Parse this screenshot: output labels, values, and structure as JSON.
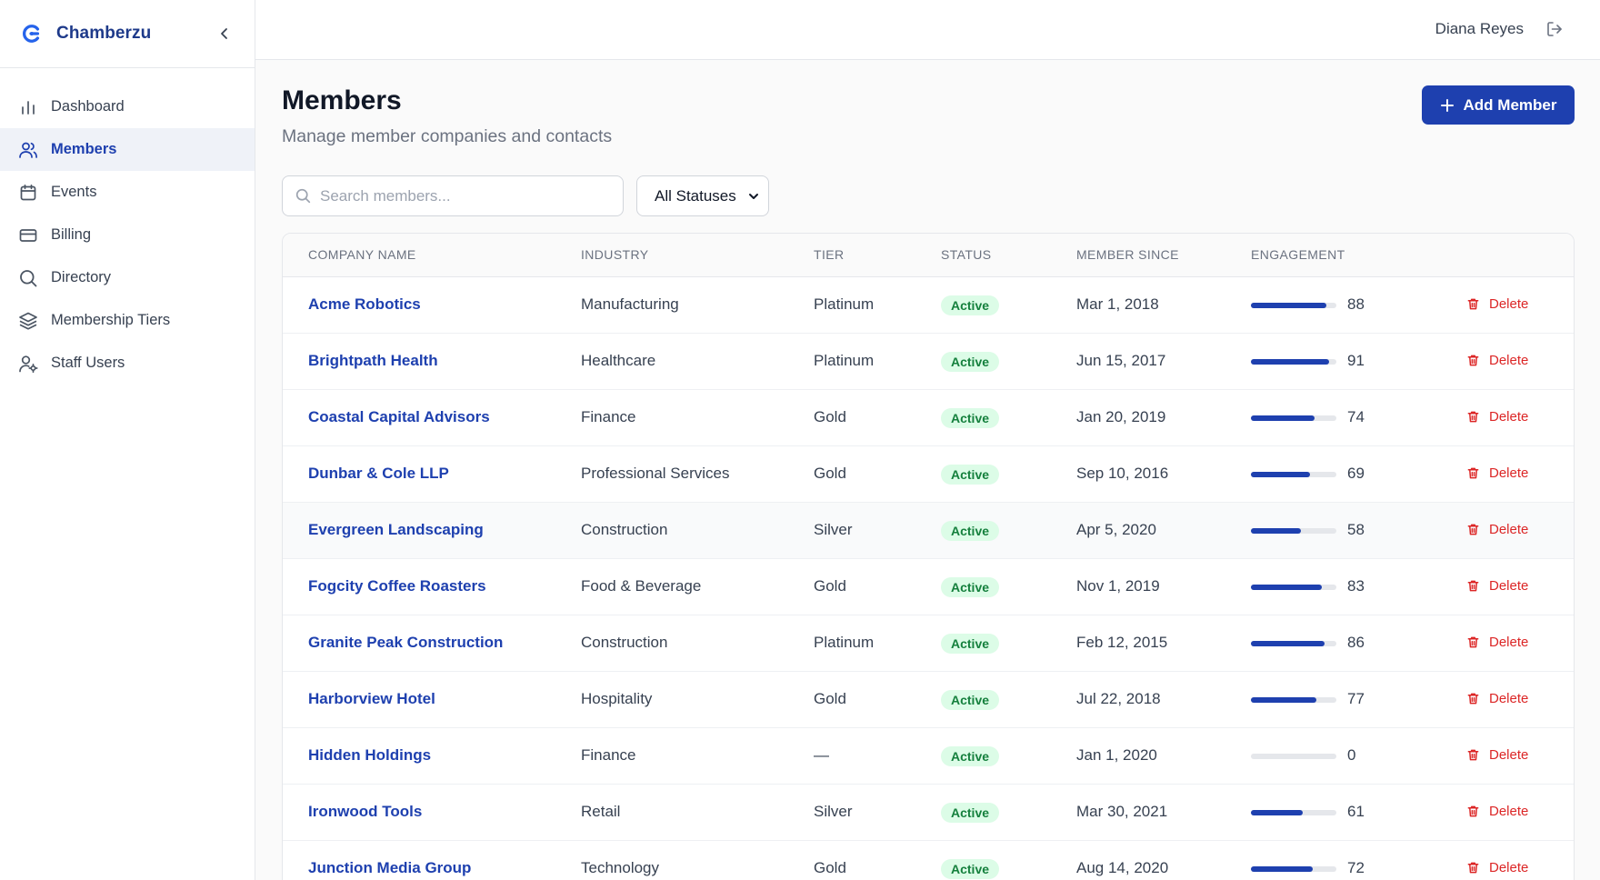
{
  "brand": {
    "name": "Chamberzu",
    "accent": "#1e40af"
  },
  "sidebar": {
    "items": [
      {
        "label": "Dashboard",
        "icon": "bar-chart-icon",
        "active": false
      },
      {
        "label": "Members",
        "icon": "users-icon",
        "active": true
      },
      {
        "label": "Events",
        "icon": "calendar-icon",
        "active": false
      },
      {
        "label": "Billing",
        "icon": "credit-card-icon",
        "active": false
      },
      {
        "label": "Directory",
        "icon": "search-icon",
        "active": false
      },
      {
        "label": "Membership Tiers",
        "icon": "layers-icon",
        "active": false
      },
      {
        "label": "Staff Users",
        "icon": "user-cog-icon",
        "active": false
      }
    ]
  },
  "topbar": {
    "user_name": "Diana Reyes",
    "logout_icon": "logout-icon"
  },
  "page": {
    "title": "Members",
    "subtitle": "Manage member companies and contacts",
    "add_button": "Add Member"
  },
  "filters": {
    "search_placeholder": "Search members...",
    "status_selected": "All Statuses"
  },
  "table": {
    "columns": [
      "COMPANY NAME",
      "INDUSTRY",
      "TIER",
      "STATUS",
      "MEMBER SINCE",
      "ENGAGEMENT"
    ],
    "delete_label": "Delete",
    "rows": [
      {
        "company": "Acme Robotics",
        "industry": "Manufacturing",
        "tier": "Platinum",
        "status": "Active",
        "since": "Mar 1, 2018",
        "engagement": 88
      },
      {
        "company": "Brightpath Health",
        "industry": "Healthcare",
        "tier": "Platinum",
        "status": "Active",
        "since": "Jun 15, 2017",
        "engagement": 91
      },
      {
        "company": "Coastal Capital Advisors",
        "industry": "Finance",
        "tier": "Gold",
        "status": "Active",
        "since": "Jan 20, 2019",
        "engagement": 74
      },
      {
        "company": "Dunbar & Cole LLP",
        "industry": "Professional Services",
        "tier": "Gold",
        "status": "Active",
        "since": "Sep 10, 2016",
        "engagement": 69
      },
      {
        "company": "Evergreen Landscaping",
        "industry": "Construction",
        "tier": "Silver",
        "status": "Active",
        "since": "Apr 5, 2020",
        "engagement": 58
      },
      {
        "company": "Fogcity Coffee Roasters",
        "industry": "Food & Beverage",
        "tier": "Gold",
        "status": "Active",
        "since": "Nov 1, 2019",
        "engagement": 83
      },
      {
        "company": "Granite Peak Construction",
        "industry": "Construction",
        "tier": "Platinum",
        "status": "Active",
        "since": "Feb 12, 2015",
        "engagement": 86
      },
      {
        "company": "Harborview Hotel",
        "industry": "Hospitality",
        "tier": "Gold",
        "status": "Active",
        "since": "Jul 22, 2018",
        "engagement": 77
      },
      {
        "company": "Hidden Holdings",
        "industry": "Finance",
        "tier": "—",
        "status": "Active",
        "since": "Jan 1, 2020",
        "engagement": 0
      },
      {
        "company": "Ironwood Tools",
        "industry": "Retail",
        "tier": "Silver",
        "status": "Active",
        "since": "Mar 30, 2021",
        "engagement": 61
      },
      {
        "company": "Junction Media Group",
        "industry": "Technology",
        "tier": "Gold",
        "status": "Active",
        "since": "Aug 14, 2020",
        "engagement": 72
      }
    ]
  }
}
